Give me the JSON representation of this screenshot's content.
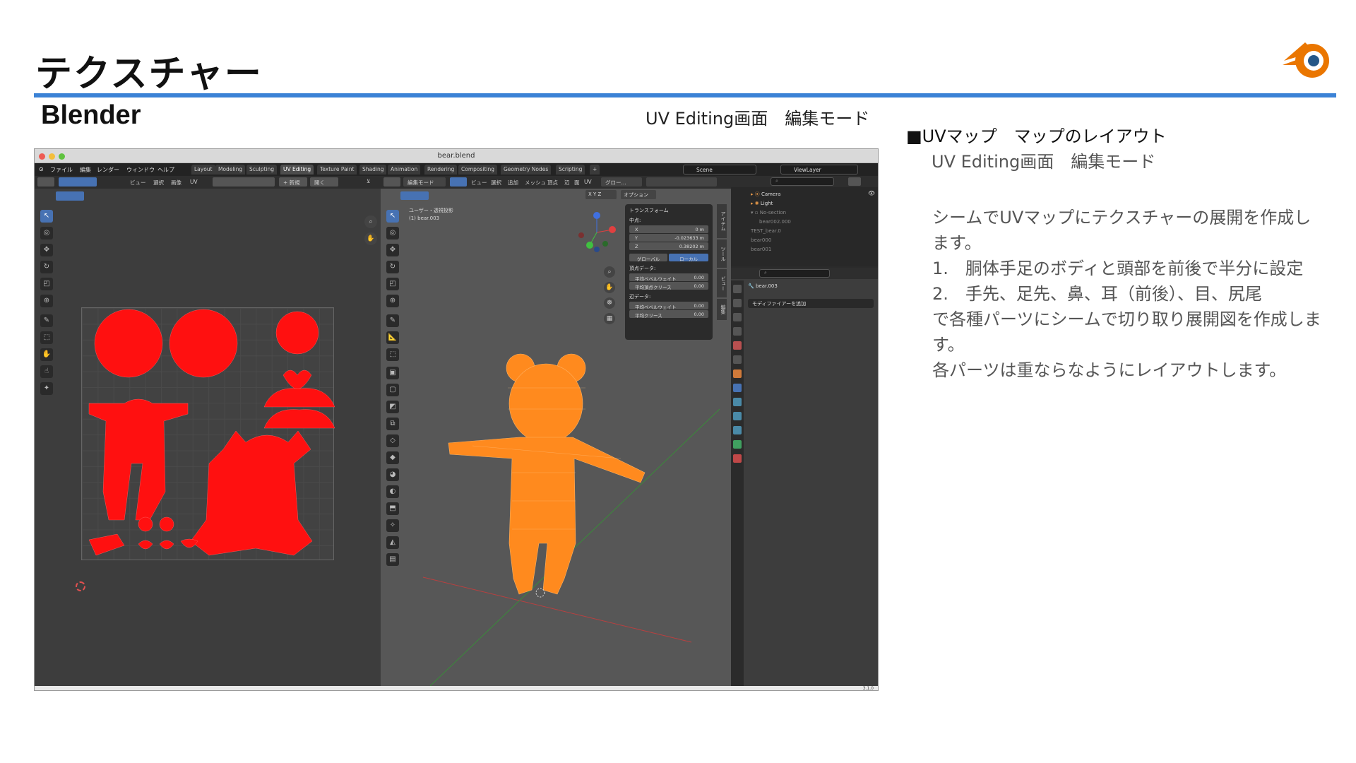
{
  "slide": {
    "title": "テクスチャー",
    "subtitle": "Blender",
    "caption": "UV Editing画面　編集モード"
  },
  "blender": {
    "file_name": "bear.blend",
    "menus": [
      "ファイル",
      "編集",
      "レンダー",
      "ウィンドウ",
      "ヘルプ"
    ],
    "workspace_tabs": [
      "Layout",
      "Modeling",
      "Sculpting",
      "UV Editing",
      "Texture Paint",
      "Shading",
      "Animation",
      "Rendering",
      "Compositing",
      "Geometry Nodes",
      "Scripting"
    ],
    "active_tab": "UV Editing",
    "scene": "Scene",
    "view_layer": "ViewLayer",
    "uv_header": [
      "ビュー",
      "選択",
      "画像",
      "UV"
    ],
    "uv_new_button": "新規",
    "uv_open_button": "開く",
    "viewport_mode": "編集モード",
    "viewport_header": [
      "ビュー",
      "選択",
      "追加",
      "メッシュ",
      "頂点",
      "辺",
      "面",
      "UV"
    ],
    "viewport_orientation": "グロー...",
    "viewport_options": "オプション",
    "viewport_label_1": "ユーザー・透視投影",
    "viewport_label_2": "(1) bear.003",
    "transform_panel": {
      "title": "トランスフォーム",
      "median": "中点:",
      "x_label": "X",
      "x_value": "0 m",
      "y_label": "Y",
      "y_value": "-0.023633 m",
      "z_label": "Z",
      "z_value": "0.38202 m",
      "global": "グローバル",
      "local": "ローカル",
      "vertex_data": "頂点データ:",
      "mean_bevel_weight": "平均ベベルウェイト",
      "mean_bevel_value": "0.00",
      "mean_vertex_crease": "平均頂点クリース",
      "mean_vertex_crease_value": "0.00",
      "edge_data": "辺データ:",
      "edge_bevel_weight": "平均ベベルウェイト",
      "edge_bevel_value": "0.00",
      "edge_crease": "平均クリース",
      "edge_crease_value": "0.00"
    },
    "side_tabs": [
      "アイテム",
      "ツール",
      "ビュー",
      "編集"
    ],
    "outliner": [
      "Camera",
      "Light",
      "No-section",
      "bear002.000",
      "TEST_bear.0",
      "bear000",
      "bear001"
    ],
    "properties_object": "bear.003",
    "add_modifier": "モディファイアーを追加",
    "version": "3.1.0",
    "colors": {
      "accent": "#4772b3",
      "uv_island": "#ff1010",
      "mesh": "#ff8a1e",
      "blender_orange": "#ea7600",
      "blender_blue": "#265787"
    }
  },
  "right": {
    "heading": "■UVマップ　マップのレイアウト",
    "sub": "UV Editing画面　編集モード",
    "lines": [
      "シームでUVマップにテクスチャーの展開を作成し",
      "ます。",
      "1.　胴体手足のボディと頭部を前後で半分に設定",
      "2.　手先、足先、鼻、耳（前後）、目、尻尾",
      "で各種パーツにシームで切り取り展開図を作成しま",
      "す。",
      "各パーツは重ならなようにレイアウトします。"
    ]
  }
}
